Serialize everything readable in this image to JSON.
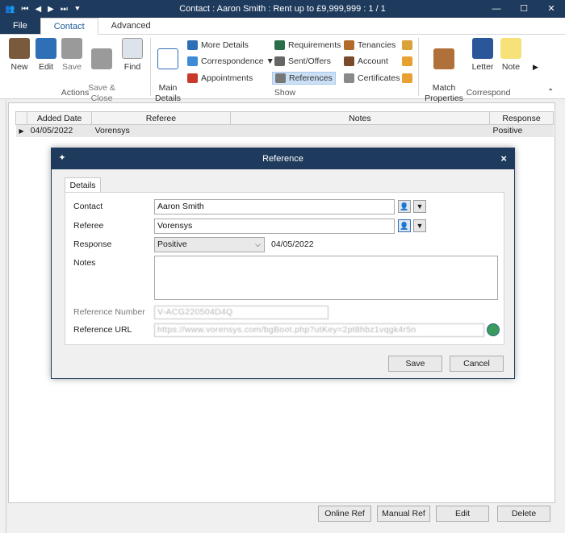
{
  "window": {
    "title": "Contact : Aaron Smith : Rent up to £9,999,999 : 1 / 1",
    "minimize": "—",
    "maximize": "☐",
    "close": "✕"
  },
  "tabs": {
    "file": "File",
    "contact": "Contact",
    "advanced": "Advanced"
  },
  "ribbon": {
    "actions": {
      "label": "Actions",
      "new": "New",
      "edit": "Edit",
      "save": "Save",
      "save_close": "Save &\nClose",
      "find": "Find"
    },
    "show": {
      "label": "Show",
      "main_details": "Main\nDetails",
      "more_details": "More Details",
      "correspondence": "Correspondence ▼",
      "appointments": "Appointments",
      "requirements": "Requirements",
      "sent_offers": "Sent/Offers",
      "references": "References",
      "tenancies": "Tenancies",
      "account": "Account",
      "certificates": "Certificates"
    },
    "correspond": {
      "label": "Correspond",
      "match_properties": "Match\nProperties",
      "letter": "Letter",
      "note": "Note"
    }
  },
  "grid": {
    "columns": [
      "Added Date",
      "Referee",
      "Notes",
      "Response"
    ],
    "rows": [
      {
        "added_date": "04/05/2022",
        "referee": "Vorensys",
        "notes": "",
        "response": "Positive"
      }
    ]
  },
  "dialog": {
    "title": "Reference",
    "tab": "Details",
    "labels": {
      "contact": "Contact",
      "referee": "Referee",
      "response": "Response",
      "notes": "Notes",
      "reference_number": "Reference Number",
      "reference_url": "Reference URL"
    },
    "values": {
      "contact": "Aaron Smith",
      "referee": "Vorensys",
      "response": "Positive",
      "response_date": "04/05/2022",
      "notes": "",
      "reference_number": "V-ACG220504D4Q",
      "reference_url": "https://www.vorensys.com/bgBoot.php?utKey=2pt8hbz1vqgk4r5n"
    },
    "buttons": {
      "save": "Save",
      "cancel": "Cancel"
    }
  },
  "bottom": {
    "online_ref": "Online Ref",
    "manual_ref": "Manual Ref",
    "edit": "Edit",
    "delete": "Delete"
  },
  "colors": {
    "titlebar": "#1e3a5c",
    "accent": "#1e5a9c"
  }
}
